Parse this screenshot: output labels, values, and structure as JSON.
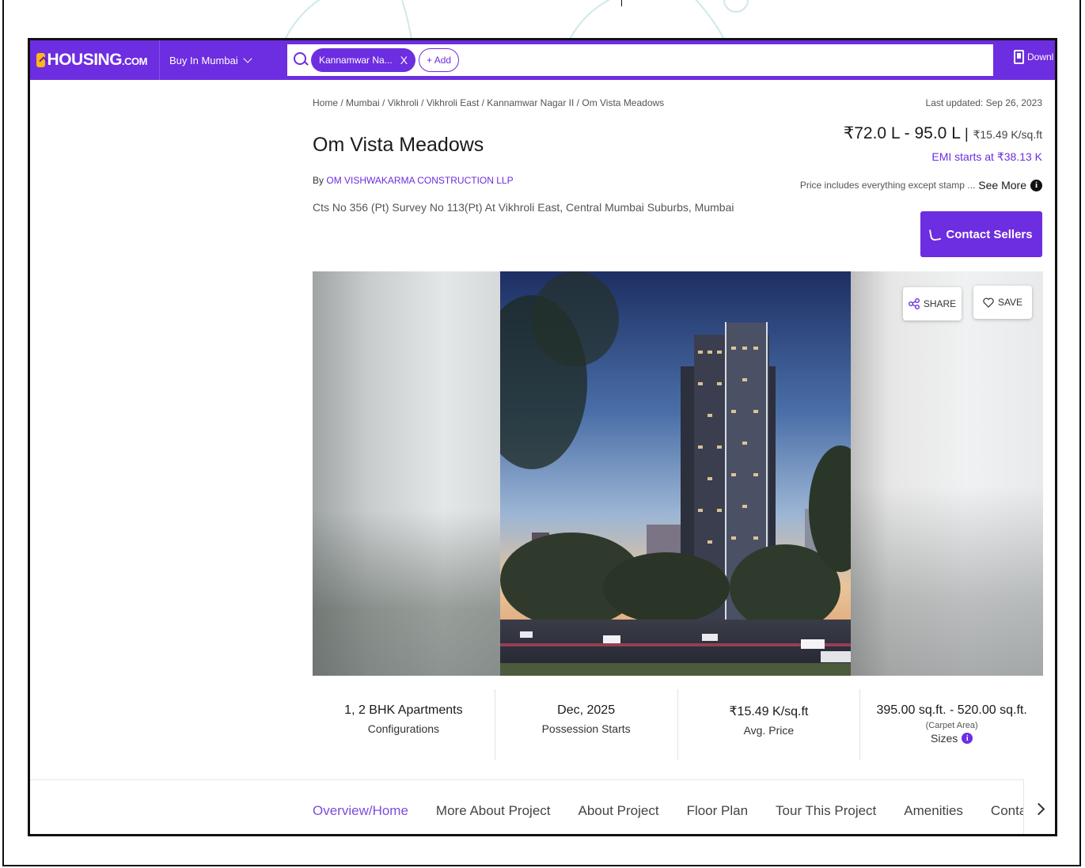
{
  "header": {
    "logo_main": "HOUSING",
    "logo_suffix": ".COM",
    "city_select": "Buy In Mumbai",
    "search_chip": "Kannamwar Na...",
    "search_chip_close": "X",
    "add_chip": "+ Add",
    "download_label": "Downl"
  },
  "breadcrumb": "Home / Mumbai / Vikhroli / Vikhroli East / Kannamwar Nagar II / Om Vista Meadows",
  "last_updated": "Last updated: Sep 26, 2023",
  "project": {
    "title": "Om Vista Meadows",
    "builder_prefix": "By",
    "builder": "OM VISHWAKARMA CONSTRUCTION LLP",
    "address": "Cts No 356 (Pt) Survey No 113(Pt) At Vikhroli East, Central Mumbai Suburbs, Mumbai"
  },
  "pricing": {
    "range": "₹72.0 L - 95.0 L",
    "separator": "|",
    "per_sqft": "₹15.49 K/sq.ft",
    "emi": "EMI starts at ₹38.13 K",
    "note": "Price includes everything except stamp ...",
    "see_more": "See More",
    "info_glyph": "i"
  },
  "contact_button": "Contact Sellers",
  "gallery": {
    "share_label": "SHARE",
    "save_label": "SAVE"
  },
  "stats": [
    {
      "value": "1, 2 BHK Apartments",
      "label": "Configurations"
    },
    {
      "value": "Dec, 2025",
      "label": "Possession Starts"
    },
    {
      "value": "₹15.49 K/sq.ft",
      "label": "Avg. Price"
    },
    {
      "value": "395.00 sq.ft. - 520.00 sq.ft.",
      "sub": "(Carpet Area)",
      "label": "Sizes",
      "info_glyph": "i"
    }
  ],
  "tabs": [
    {
      "label": "Overview/Home",
      "active": true
    },
    {
      "label": "More About Project"
    },
    {
      "label": "About Project"
    },
    {
      "label": "Floor Plan"
    },
    {
      "label": "Tour This Project"
    },
    {
      "label": "Amenities"
    },
    {
      "label": "Contact Sellers"
    }
  ],
  "colors": {
    "brand": "#6d2de0",
    "logo_accent": "#fdb813",
    "active_tab": "#7c4ddc"
  }
}
